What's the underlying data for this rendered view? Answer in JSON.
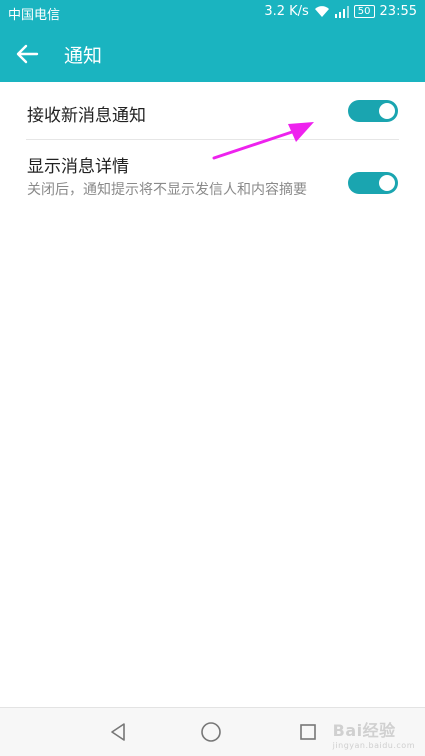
{
  "status_bar": {
    "carrier": "中国电信",
    "speed": "3.2 K/s",
    "battery": "50",
    "time": "23:55"
  },
  "app_bar": {
    "title": "通知",
    "back_icon": "arrow-left-icon"
  },
  "settings": [
    {
      "label": "接收新消息通知",
      "sublabel": "",
      "enabled": true
    },
    {
      "label": "显示消息详情",
      "sublabel": "关闭后，通知提示将不显示发信人和内容摘要",
      "enabled": true
    }
  ],
  "nav_bar": {
    "icons": [
      "triangle-back-icon",
      "circle-home-icon",
      "square-recents-icon"
    ]
  },
  "watermark": {
    "text": "Bai经验",
    "url": "jingyan.baidu.com"
  },
  "colors": {
    "accent": "#1ab4c0",
    "toggle_on": "#1aa5b0",
    "annotation_arrow": "#ee22ee"
  }
}
